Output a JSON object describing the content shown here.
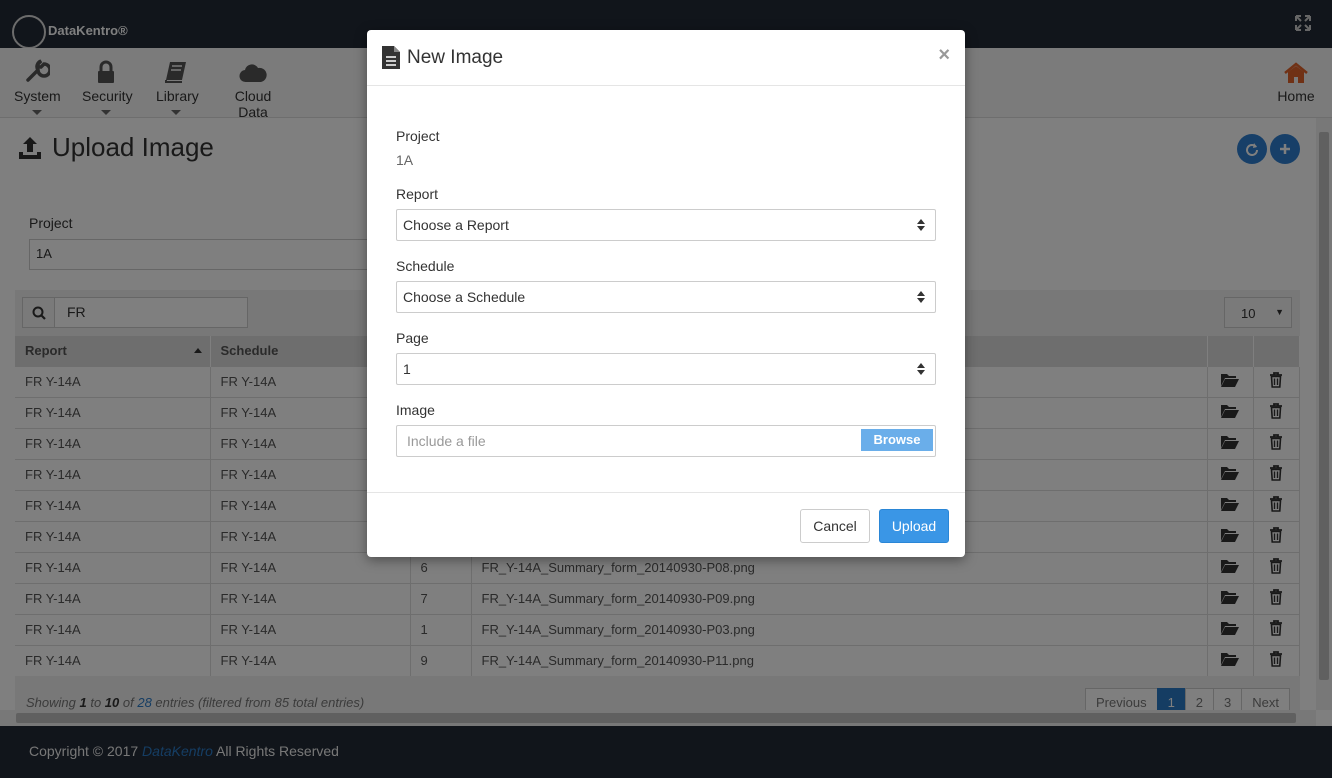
{
  "app": {
    "brand": "DataKentro®"
  },
  "nav": {
    "items": [
      {
        "label": "System",
        "icon": "wrench-icon"
      },
      {
        "label": "Security",
        "icon": "lock-icon"
      },
      {
        "label": "Library",
        "icon": "book-icon"
      },
      {
        "label": "Cloud Data",
        "icon": "cloud-icon"
      }
    ],
    "home": {
      "label": "Home",
      "icon": "home-icon"
    }
  },
  "page": {
    "title": "Upload Image",
    "project_label": "Project",
    "project_value": "1A"
  },
  "table": {
    "search_value": "FR",
    "length_value": "10",
    "columns": [
      "Report",
      "Schedule"
    ],
    "rows": [
      {
        "report": "FR Y-14A",
        "schedule": "FR Y-14A",
        "page": "",
        "file": ""
      },
      {
        "report": "FR Y-14A",
        "schedule": "FR Y-14A",
        "page": "",
        "file": ""
      },
      {
        "report": "FR Y-14A",
        "schedule": "FR Y-14A",
        "page": "",
        "file": ""
      },
      {
        "report": "FR Y-14A",
        "schedule": "FR Y-14A",
        "page": "",
        "file": ""
      },
      {
        "report": "FR Y-14A",
        "schedule": "FR Y-14A",
        "page": "",
        "file": ""
      },
      {
        "report": "FR Y-14A",
        "schedule": "FR Y-14A",
        "page": "",
        "file": ""
      },
      {
        "report": "FR Y-14A",
        "schedule": "FR Y-14A",
        "page": "6",
        "file": "FR_Y-14A_Summary_form_20140930-P08.png"
      },
      {
        "report": "FR Y-14A",
        "schedule": "FR Y-14A",
        "page": "7",
        "file": "FR_Y-14A_Summary_form_20140930-P09.png"
      },
      {
        "report": "FR Y-14A",
        "schedule": "FR Y-14A",
        "page": "1",
        "file": "FR_Y-14A_Summary_form_20140930-P03.png"
      },
      {
        "report": "FR Y-14A",
        "schedule": "FR Y-14A",
        "page": "9",
        "file": "FR_Y-14A_Summary_form_20140930-P11.png"
      }
    ],
    "info": {
      "prefix": "Showing ",
      "from": "1",
      "to_word": " to ",
      "to": "10",
      "of_word": " of ",
      "total": "28",
      "suffix": " entries (filtered from 85 total entries)"
    },
    "pager": {
      "previous": "Previous",
      "pages": [
        "1",
        "2",
        "3"
      ],
      "next": "Next"
    }
  },
  "footer": {
    "prefix": "Copyright © 2017 ",
    "link": "DataKentro",
    "suffix": " All Rights Reserved"
  },
  "modal": {
    "title": "New Image",
    "close": "×",
    "project_label": "Project",
    "project_value": "1A",
    "report_label": "Report",
    "report_value": "Choose a Report",
    "schedule_label": "Schedule",
    "schedule_value": "Choose a Schedule",
    "page_label": "Page",
    "page_value": "1",
    "image_label": "Image",
    "image_placeholder": "Include a file",
    "browse": "Browse",
    "cancel": "Cancel",
    "upload": "Upload"
  },
  "colors": {
    "topbar": "#222a36",
    "accent": "#3a96e6",
    "home": "#e0622a"
  }
}
